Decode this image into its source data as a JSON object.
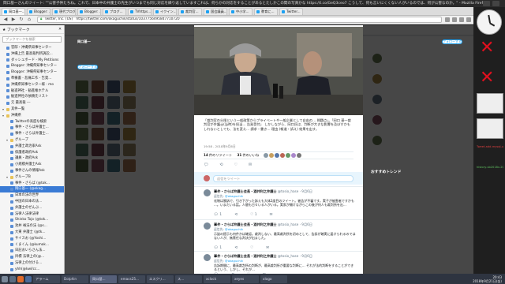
{
  "window": {
    "title": "岡口基一さんのツイート: \"\"公害子供たちね。これで、日本中の弁護士の先生がいつまでも同じ対応を繰り返していますこれは、何らかの対応をすることがあるとたしかこの間の写真かな https://t.co/GeQ3ceo7 こうして、何も言いにくくない人がいるのでは、何が公害なのか。\" - Mozilla Firefox"
  },
  "tabs": [
    {
      "label": "岡口基一...",
      "active": true
    },
    {
      "label": "Blogger: ...",
      "active": false
    },
    {
      "label": "現代ブログ...",
      "active": false
    },
    {
      "label": "Blogger: ...",
      "active": false
    },
    {
      "label": "ブログ...",
      "active": false
    },
    {
      "label": "TVhttps...",
      "active": false
    },
    {
      "label": "イクイン...",
      "active": false
    },
    {
      "label": "裁判官...",
      "active": false
    },
    {
      "label": "国会議員...",
      "active": false
    },
    {
      "label": "中小学...",
      "active": false
    },
    {
      "label": "教育に...",
      "active": false
    },
    {
      "label": "Twitter...",
      "active": false
    }
  ],
  "navbar": {
    "url": "https://twitter.com/okaguchik/status/1037756495847710720",
    "site_label": "Twitter, Inc. (US)"
  },
  "sidebar": {
    "title": "ブックマーク",
    "search_placeholder": "ブックマークを検索",
    "items": [
      {
        "label": "官邸・沖縄県知事センター",
        "type": "link",
        "indent": 1
      },
      {
        "label": "沖縄上告 最高裁判所訴訟...",
        "type": "link",
        "indent": 1
      },
      {
        "label": "ダッシュボード - My Petitions",
        "type": "link",
        "indent": 1
      },
      {
        "label": "Blogger: 沖縄県知事センター",
        "type": "link",
        "indent": 1
      },
      {
        "label": "Blogger: 沖縄県知事センター",
        "type": "link",
        "indent": 1
      },
      {
        "label": "準備書 - 悲痛工作 - 告発…",
        "type": "link",
        "indent": 1
      },
      {
        "label": "沖縄県知事センター様 - mo",
        "type": "link",
        "indent": 1
      },
      {
        "label": "勧進神社 - 勧進帳ホテル",
        "type": "link",
        "indent": 1
      },
      {
        "label": "勧進神社の依頼先リスト",
        "type": "link",
        "indent": 1
      },
      {
        "label": "元 最高裁 ---",
        "type": "link",
        "indent": 1
      },
      {
        "label": "其件一覧",
        "type": "folder",
        "indent": 0
      },
      {
        "label": "沖縄県",
        "type": "folder",
        "indent": 0
      },
      {
        "label": "Twitterの高度な検索",
        "type": "link",
        "indent": 2
      },
      {
        "label": "事件・さらば弁護士...",
        "type": "link",
        "indent": 2
      },
      {
        "label": "事件・さらば弁護士...",
        "type": "link",
        "indent": 2
      },
      {
        "label": "グループ",
        "type": "folder",
        "indent": 1
      },
      {
        "label": "弁護士政治家Ask",
        "type": "link",
        "indent": 2
      },
      {
        "label": "保護者政府Ask",
        "type": "link",
        "indent": 2
      },
      {
        "label": "議員・政府Ask",
        "type": "link",
        "indent": 2
      },
      {
        "label": "小規模弁護士Ask",
        "type": "link",
        "indent": 2
      },
      {
        "label": "事件さんの情報Ask",
        "type": "link",
        "indent": 2
      },
      {
        "label": "グループB",
        "type": "folder",
        "indent": 1
      },
      {
        "label": "事件・さらば (@tok...",
        "type": "link",
        "indent": 2
      },
      {
        "label": "岡口基一 (@okag...",
        "type": "link",
        "indent": 2,
        "selected": true
      },
      {
        "label": "日本の法の世界",
        "type": "link",
        "indent": 2
      },
      {
        "label": "中国の日本の法...",
        "type": "link",
        "indent": 2
      },
      {
        "label": "弁護士のぜんぶ...",
        "type": "link",
        "indent": 2
      },
      {
        "label": "法律人法律法律",
        "type": "link",
        "indent": 2
      },
      {
        "label": "Shinko Tojo (@tok...",
        "type": "link",
        "indent": 2
      },
      {
        "label": "池井 裕法の法 (@s...",
        "type": "link",
        "indent": 2
      },
      {
        "label": "大東 弁護士 (@tk...",
        "type": "link",
        "indent": 2
      },
      {
        "label": "サイスお (@Yoshi...",
        "type": "link",
        "indent": 2
      },
      {
        "label": "くまくん (@kumak...",
        "type": "link",
        "indent": 2
      },
      {
        "label": "日記おいらさん法...",
        "type": "link",
        "indent": 2
      },
      {
        "label": "目標 法律上の(@...",
        "type": "link",
        "indent": 2
      },
      {
        "label": "法律上の付ける...",
        "type": "link",
        "indent": 2
      },
      {
        "label": "yhh(@kwl/cc...",
        "type": "link",
        "indent": 2
      }
    ]
  },
  "page": {
    "bg_trend_title": "おすすめトレンド",
    "bg_profile_name": "岡口基一",
    "follow_label": "フォローする"
  },
  "modal": {
    "caption": "「裁判官の分限という一般政策からプライベートや一般企業として自由の… 問題点」。「岡口 基一裁判官が弁護士(当時)を担当… 告発受付」 しかしながら、岡口氏は、判断が大きな影響を及ぼすかもしれないとしても、法を変え… 請求・書き… 理由 (報道・訴え) 結果を出す。",
    "time": "19:58 - 2018年9月6日",
    "retweets": "14",
    "retweets_label": "件のリツイート",
    "likes": "31",
    "likes_label": "件のいいね",
    "action_icons": [
      "reply-icon",
      "retweet-icon",
      "like-icon",
      "dm-icon"
    ],
    "reply_placeholder": "返信をツイート",
    "replies": [
      {
        "name": "事件・さらば弁護士会長・酒井利之弁護士",
        "handle": "@tosio_hase · 9月6日",
        "to_label": "返信先:",
        "to_handle": "@okaguchik",
        "text": "化物は勝訴で、引き下がった訴えも大体2度目のツイート。被告が不審です。実子が被害者ですかも ...。いまだいる話。人間も日々いる人がいる。実家が開けながらこの後が何人も裁判所を出…",
        "actions": [
          "1",
          "",
          "1"
        ]
      },
      {
        "name": "事件・さらば弁護士会長・酒井利之弁護士",
        "handle": "@tosio_hase · 9月6日",
        "to_label": "返信先:",
        "to_handle": "@okaguchik",
        "text": "示談の提示も何件かは確認。裁判しない、最高裁判所を初めとして、告訴が確実に届けられるのではない人が、無責任な判決が出ました。",
        "actions": [
          "1",
          "",
          ""
        ]
      },
      {
        "name": "事件・さらば弁護士会長・酒井利之弁護士",
        "handle": "@tosio_hase · 9月6日",
        "to_label": "返信先:",
        "to_handle": "@okaguchik",
        "text": "告訴期間に、最高裁判所の判断が、最高裁判所が重要な判断に… それが法的判断をすることができるという、しかし、それが…",
        "actions": [
          "",
          "",
          ""
        ]
      }
    ]
  },
  "desktop": {
    "note1": "Tweet-add-mysql-use-F...",
    "note2": "history-sb2018v-20..."
  },
  "taskbar": {
    "tasks": [
      {
        "label": "アラーム",
        "active": false
      },
      {
        "label": "Dolphin",
        "active": false
      },
      {
        "label": "岡口基...",
        "active": true
      },
      {
        "label": "emacs25...",
        "active": false
      },
      {
        "label": "エスクリ...",
        "active": false
      },
      {
        "label": "ス...",
        "active": false
      },
      {
        "label": "xclock",
        "active": false
      },
      {
        "label": "xeyes",
        "active": false
      },
      {
        "label": "xlogo",
        "active": false
      }
    ],
    "time": "20:43",
    "date": "2018年9月21日(金)"
  }
}
